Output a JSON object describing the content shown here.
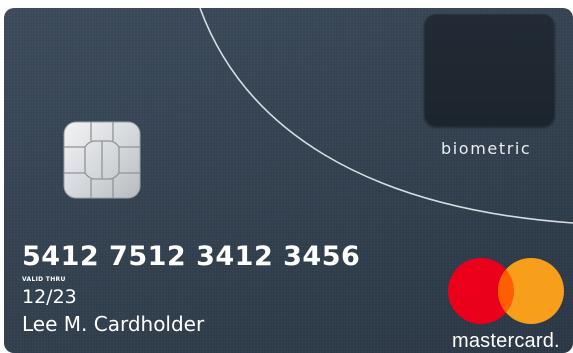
{
  "card": {
    "number": "5412 7512 3412 3456",
    "valid_thru_label": "VALID THRU",
    "expiry": "12/23",
    "holder": "Lee M. Cardholder",
    "sensor_label": "biometric"
  },
  "brand": {
    "wordmark": "mastercard.",
    "red": "#eb001b",
    "orange": "#f79e1b",
    "overlap": "#ff5f00"
  },
  "icons": [
    "emv-chip-icon",
    "fingerprint-sensor",
    "mastercard-logo"
  ]
}
